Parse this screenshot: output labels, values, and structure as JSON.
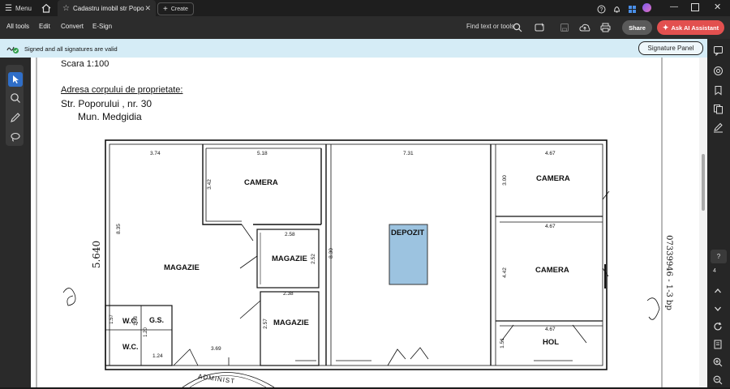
{
  "tabbar": {
    "menu_label": "Menu",
    "tab_title": "Cadastru imobil str Popo",
    "create_label": "Create"
  },
  "toolbar": {
    "items": [
      "All tools",
      "Edit",
      "Convert",
      "E-Sign"
    ],
    "find_label": "Find text or tools",
    "share_label": "Share",
    "ai_label": "Ask AI Assistant"
  },
  "banner": {
    "text": "Signed and all signatures are valid",
    "signature_panel_label": "Signature Panel"
  },
  "document": {
    "scale": "Scara 1:100",
    "address_heading": "Adresa corpului de proprietate:",
    "street": "Str. Poporului , nr. 30",
    "city": "Mun. Medgidia",
    "rooms": {
      "camera1": "CAMERA",
      "magazie_main": "MAGAZIE",
      "magazie_2": "MAGAZIE",
      "magazie_3": "MAGAZIE",
      "depozit": "DEPOZIT",
      "camera2": "CAMERA",
      "camera3": "CAMERA",
      "hol": "HOL",
      "wc1": "W.C.",
      "wc2": "W.C.",
      "gs": "G.S."
    },
    "dimensions": {
      "d374": "3.74",
      "d518": "5.18",
      "d731": "7.31",
      "d467a": "4.67",
      "d467b": "4.67",
      "d467c": "4.67",
      "d342": "3.42",
      "d835": "8.35",
      "d258": "2.58",
      "d252": "2.52",
      "d238": "2.38",
      "d257": "2.57",
      "d830": "8.30",
      "d300": "3.00",
      "d442": "4.42",
      "d151": "1.51",
      "d369": "3.69",
      "d124": "1.24",
      "d157": "1.57",
      "d153": "1.53",
      "d120": "1.20"
    },
    "margin_left": "5.640",
    "margin_right": "07339946 - 1-3 bp",
    "stamp": "ADMINIST"
  },
  "colors": {
    "accent_blue": "#2f6ec8",
    "ai_red": "#e2504f",
    "banner_bg": "#d5ecf6",
    "depozit_fill": "#9cc3e0"
  }
}
